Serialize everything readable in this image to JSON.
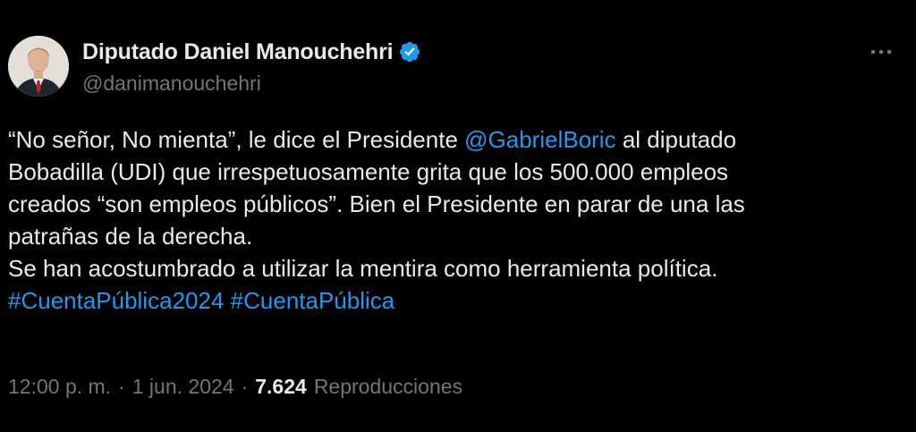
{
  "author": {
    "display_name": "Diputado Daniel Manouchehri",
    "handle": "@danimanouchehri",
    "verified_icon": "verified-badge-icon",
    "avatar": "avatar"
  },
  "more_icon": "more-options-icon",
  "tweet": {
    "lines": [
      {
        "pre": "“No señor, No mienta”, le dice el Presidente ",
        "link": "@GabrielBoric",
        "post": " al diputado"
      },
      {
        "text": "Bobadilla (UDI) que irrespetuosamente grita que los 500.000 empleos"
      },
      {
        "text": "creados “son empleos públicos”. Bien el Presidente en parar de una las"
      },
      {
        "text": "patrañas de la derecha."
      },
      {
        "text": "Se han acostumbrado a utilizar la mentira como herramienta política."
      }
    ],
    "hashtags": [
      "#CuentaPública2024",
      "#CuentaPública"
    ]
  },
  "meta": {
    "time": "12:00 p. m.",
    "separator": "·",
    "date": "1 jun. 2024",
    "views_count": "7.624",
    "views_label": "Reproducciones"
  },
  "colors": {
    "background": "#000000",
    "text": "#e7e9ea",
    "secondary": "#71767b",
    "link": "#1d9bf0"
  }
}
